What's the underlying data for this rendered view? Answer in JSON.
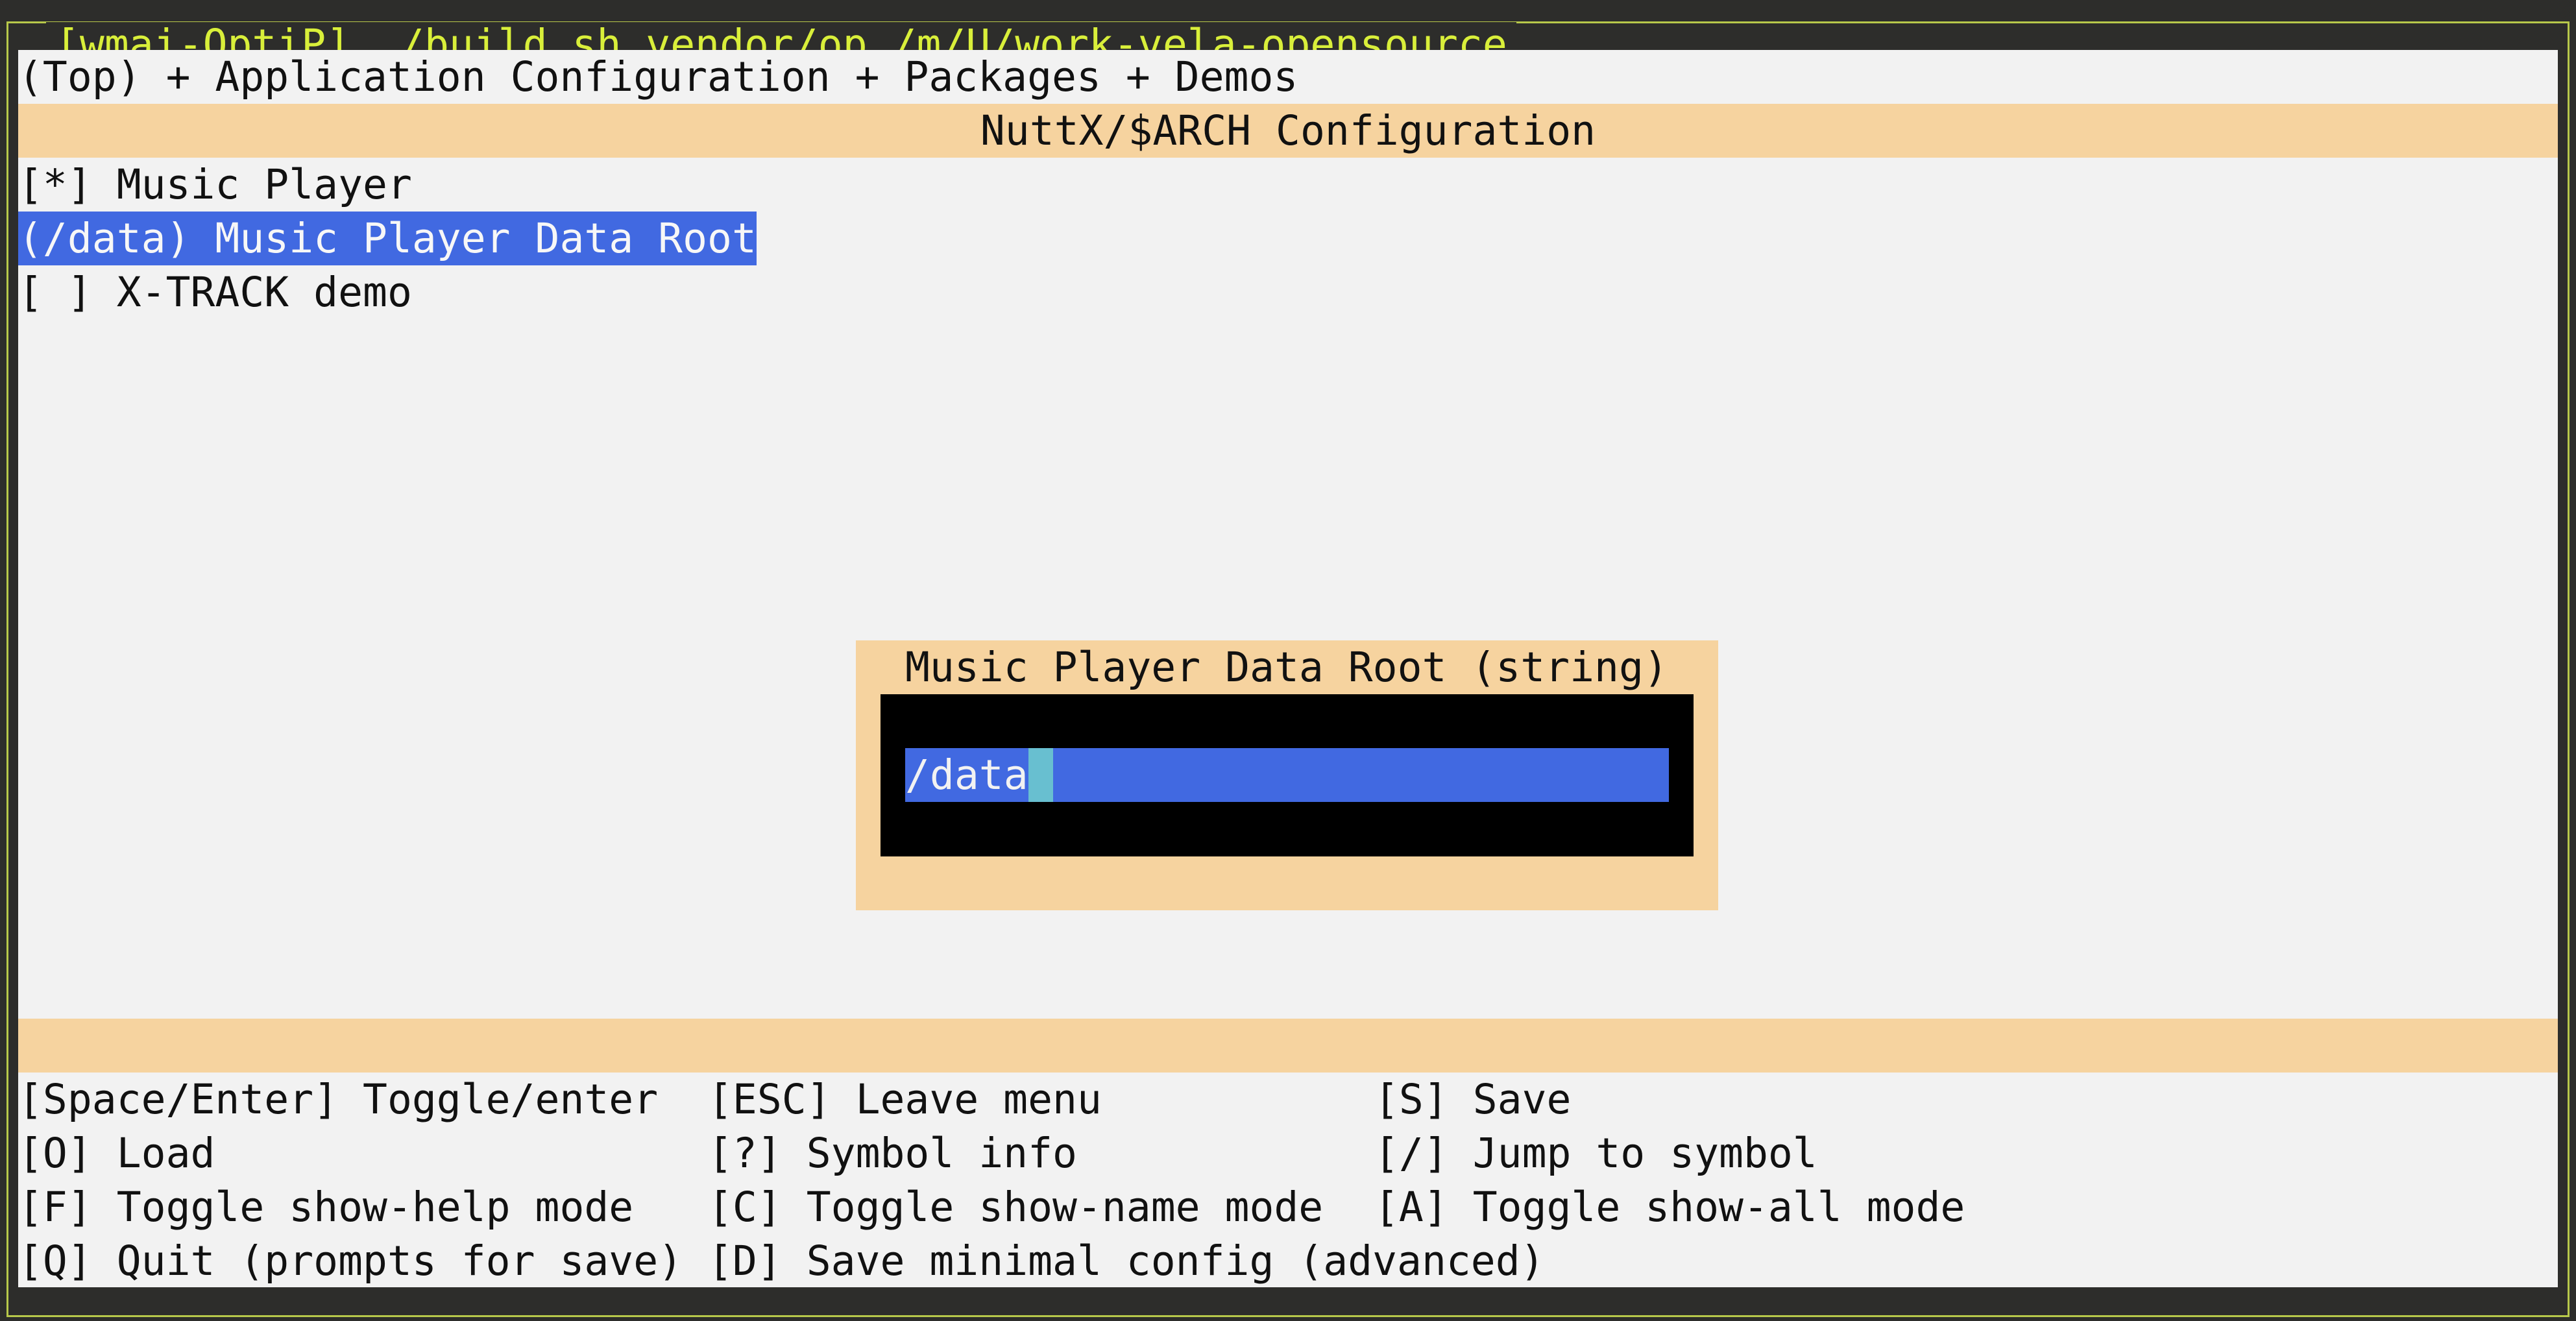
{
  "window": {
    "title": "[wmai-OptiP] ./build.sh vendor/op /m/U/work-vela-opensource"
  },
  "breadcrumb": "(Top) + Application Configuration + Packages + Demos",
  "config_title": "NuttX/$ARCH Configuration",
  "menu": {
    "items": [
      {
        "label": "[*] Music Player",
        "selected": false
      },
      {
        "label": "(/data) Music Player Data Root",
        "selected": true
      },
      {
        "label": "[ ] X-TRACK demo",
        "selected": false
      }
    ]
  },
  "dialog": {
    "title": "Music Player Data Root (string)",
    "value": "/data"
  },
  "help": [
    "[Space/Enter] Toggle/enter",
    "[ESC] Leave menu",
    "[S] Save",
    "[O] Load",
    "[?] Symbol info",
    "[/] Jump to symbol",
    "[F] Toggle show-help mode",
    "[C] Toggle show-name mode",
    "[A] Toggle show-all mode",
    "[Q] Quit (prompts for save)",
    "[D] Save minimal config (advanced)"
  ],
  "colors": {
    "border": "#b7c84a",
    "title_text": "#d9ef3a",
    "band": "#f6d39f",
    "selection": "#4169e1",
    "cursor": "#68bfd0",
    "background": "#f2f2f2"
  }
}
